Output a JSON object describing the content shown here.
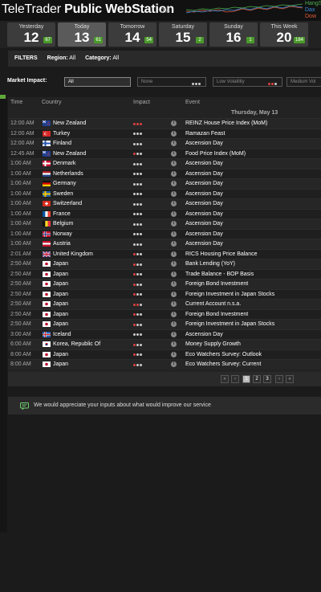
{
  "header": {
    "brand_light": "TeleTrader",
    "brand_bold": " Public WebStation",
    "percent": "0%",
    "indices": [
      {
        "name": "HangS",
        "color": "#4caf50"
      },
      {
        "name": "Dax",
        "color": "#3a8fe0"
      },
      {
        "name": "Dow",
        "color": "#e05a3a"
      }
    ]
  },
  "days": [
    {
      "name": "Yesterday",
      "num": "12",
      "count": "67",
      "active": false
    },
    {
      "name": "Today",
      "num": "13",
      "count": "61",
      "active": true
    },
    {
      "name": "Tomorrow",
      "num": "14",
      "count": "54",
      "active": false
    },
    {
      "name": "Saturday",
      "num": "15",
      "count": "2",
      "active": false
    },
    {
      "name": "Sunday",
      "num": "16",
      "count": "1",
      "active": false
    },
    {
      "name": "This Week",
      "num": "20",
      "count": "184",
      "active": false
    }
  ],
  "filters": {
    "label": "FILTERS",
    "region_label": "Region:",
    "region_value": "All",
    "category_label": "Category:",
    "category_value": "All"
  },
  "impact": {
    "label": "Market Impact:",
    "options": [
      {
        "label": "All",
        "dots": [],
        "selected": true
      },
      {
        "label": "None",
        "dots": [
          "white",
          "white",
          "white"
        ],
        "selected": false
      },
      {
        "label": "Low Volatility",
        "dots": [
          "red",
          "red",
          "white"
        ],
        "selected": false
      },
      {
        "label": "Medium Vol",
        "dots": [],
        "selected": false
      }
    ]
  },
  "table": {
    "headers": {
      "time": "Time",
      "country": "Country",
      "impact": "Impact",
      "event": "Event"
    },
    "date_heading": "Thursday, May 13",
    "rows": [
      {
        "time": "12:00 AM",
        "flag": "nz",
        "country": "New Zealand",
        "impact": 3,
        "event": "REINZ House Price Index (MoM)"
      },
      {
        "time": "12:00 AM",
        "flag": "tr",
        "country": "Turkey",
        "impact": 0,
        "event": "Ramazan Feast"
      },
      {
        "time": "12:00 AM",
        "flag": "fi",
        "country": "Finland",
        "impact": 0,
        "event": "Ascension Day"
      },
      {
        "time": "12:45 AM",
        "flag": "nz",
        "country": "New Zealand",
        "impact": 1,
        "event": "Food Price Index (MoM)"
      },
      {
        "time": "1:00 AM",
        "flag": "dk",
        "country": "Denmark",
        "impact": 0,
        "event": "Ascension Day"
      },
      {
        "time": "1:00 AM",
        "flag": "nl",
        "country": "Netherlands",
        "impact": 0,
        "event": "Ascension Day"
      },
      {
        "time": "1:00 AM",
        "flag": "de",
        "country": "Germany",
        "impact": 0,
        "event": "Ascension Day"
      },
      {
        "time": "1:00 AM",
        "flag": "se",
        "country": "Sweden",
        "impact": 0,
        "event": "Ascension Day"
      },
      {
        "time": "1:00 AM",
        "flag": "ch",
        "country": "Switzerland",
        "impact": 0,
        "event": "Ascension Day"
      },
      {
        "time": "1:00 AM",
        "flag": "fr",
        "country": "France",
        "impact": 0,
        "event": "Ascension Day"
      },
      {
        "time": "1:00 AM",
        "flag": "be",
        "country": "Belgium",
        "impact": 0,
        "event": "Ascension Day"
      },
      {
        "time": "1:00 AM",
        "flag": "no",
        "country": "Norway",
        "impact": 0,
        "event": "Ascension Day"
      },
      {
        "time": "1:00 AM",
        "flag": "at",
        "country": "Austria",
        "impact": 0,
        "event": "Ascension Day"
      },
      {
        "time": "2:01 AM",
        "flag": "gb",
        "country": "United Kingdom",
        "impact": 1,
        "event": "RICS Housing Price Balance"
      },
      {
        "time": "2:50 AM",
        "flag": "jp",
        "country": "Japan",
        "impact": 1,
        "event": "Bank Lending (YoY)"
      },
      {
        "time": "2:50 AM",
        "flag": "jp",
        "country": "Japan",
        "impact": 1,
        "event": "Trade Balance - BOP Basis"
      },
      {
        "time": "2:50 AM",
        "flag": "jp",
        "country": "Japan",
        "impact": 1,
        "event": "Foreign Bond Investment"
      },
      {
        "time": "2:50 AM",
        "flag": "jp",
        "country": "Japan",
        "impact": 1,
        "event": "Foreign Investment in Japan Stocks"
      },
      {
        "time": "2:50 AM",
        "flag": "jp",
        "country": "Japan",
        "impact": 2,
        "event": "Current Account n.s.a."
      },
      {
        "time": "2:50 AM",
        "flag": "jp",
        "country": "Japan",
        "impact": 1,
        "event": "Foreign Bond Investment"
      },
      {
        "time": "2:50 AM",
        "flag": "jp",
        "country": "Japan",
        "impact": 1,
        "event": "Foreign Investment in Japan Stocks"
      },
      {
        "time": "3:00 AM",
        "flag": "is",
        "country": "Iceland",
        "impact": 0,
        "event": "Ascension Day"
      },
      {
        "time": "6:00 AM",
        "flag": "kr",
        "country": "Korea, Republic Of",
        "impact": 1,
        "event": "Money Supply Growth"
      },
      {
        "time": "8:00 AM",
        "flag": "jp",
        "country": "Japan",
        "impact": 1,
        "event": "Eco Watchers Survey: Outlook"
      },
      {
        "time": "8:00 AM",
        "flag": "jp",
        "country": "Japan",
        "impact": 1,
        "event": "Eco Watchers Survey: Current"
      }
    ]
  },
  "pager": {
    "first": "«",
    "prev": "‹",
    "pages": [
      "1",
      "2",
      "3"
    ],
    "current": "1",
    "next": "›",
    "last": "»"
  },
  "feedback": {
    "text": "We would appreciate your inputs about what would improve our service"
  },
  "colors": {
    "accent_green": "#4a9a2a",
    "impact_red": "#e04040"
  }
}
